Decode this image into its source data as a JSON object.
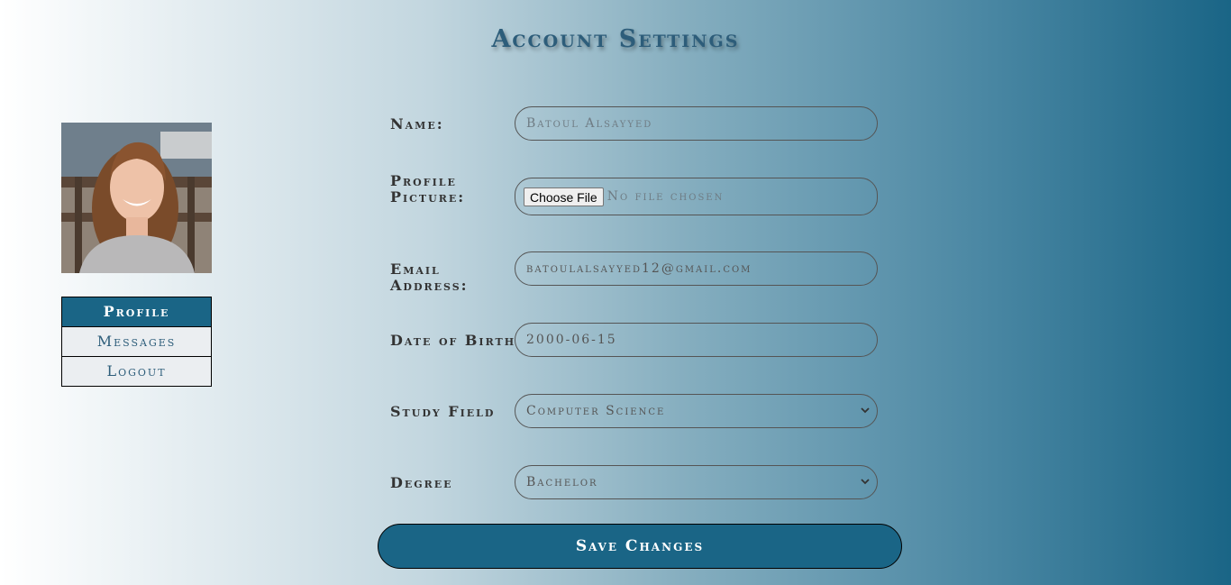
{
  "page": {
    "title": "Account Settings"
  },
  "nav": {
    "items": [
      {
        "label": "Profile",
        "active": true
      },
      {
        "label": "Messages"
      },
      {
        "label": "Logout"
      }
    ]
  },
  "form": {
    "name": {
      "label": "Name:",
      "placeholder": "Batoul Alsayyed"
    },
    "profile_picture": {
      "label_line1": "Profile",
      "label_line2": "Picture:",
      "button_label": "Choose File",
      "status": "No file chosen"
    },
    "email": {
      "label": "Email Address:",
      "value": "batoulalsayyed12@gmail.com"
    },
    "dob": {
      "label": "Date of Birth",
      "value": "2000-06-15"
    },
    "study_field": {
      "label": "Study Field",
      "selected": "Computer Science"
    },
    "degree": {
      "label": "Degree",
      "selected": "Bachelor"
    }
  },
  "save_label": "Save Changes",
  "colors": {
    "accent": "#1a6586",
    "title": "#2d5d7a",
    "nav_bg": "#ebeef1"
  },
  "icons": {
    "select_arrow": "chevron-down-icon"
  }
}
